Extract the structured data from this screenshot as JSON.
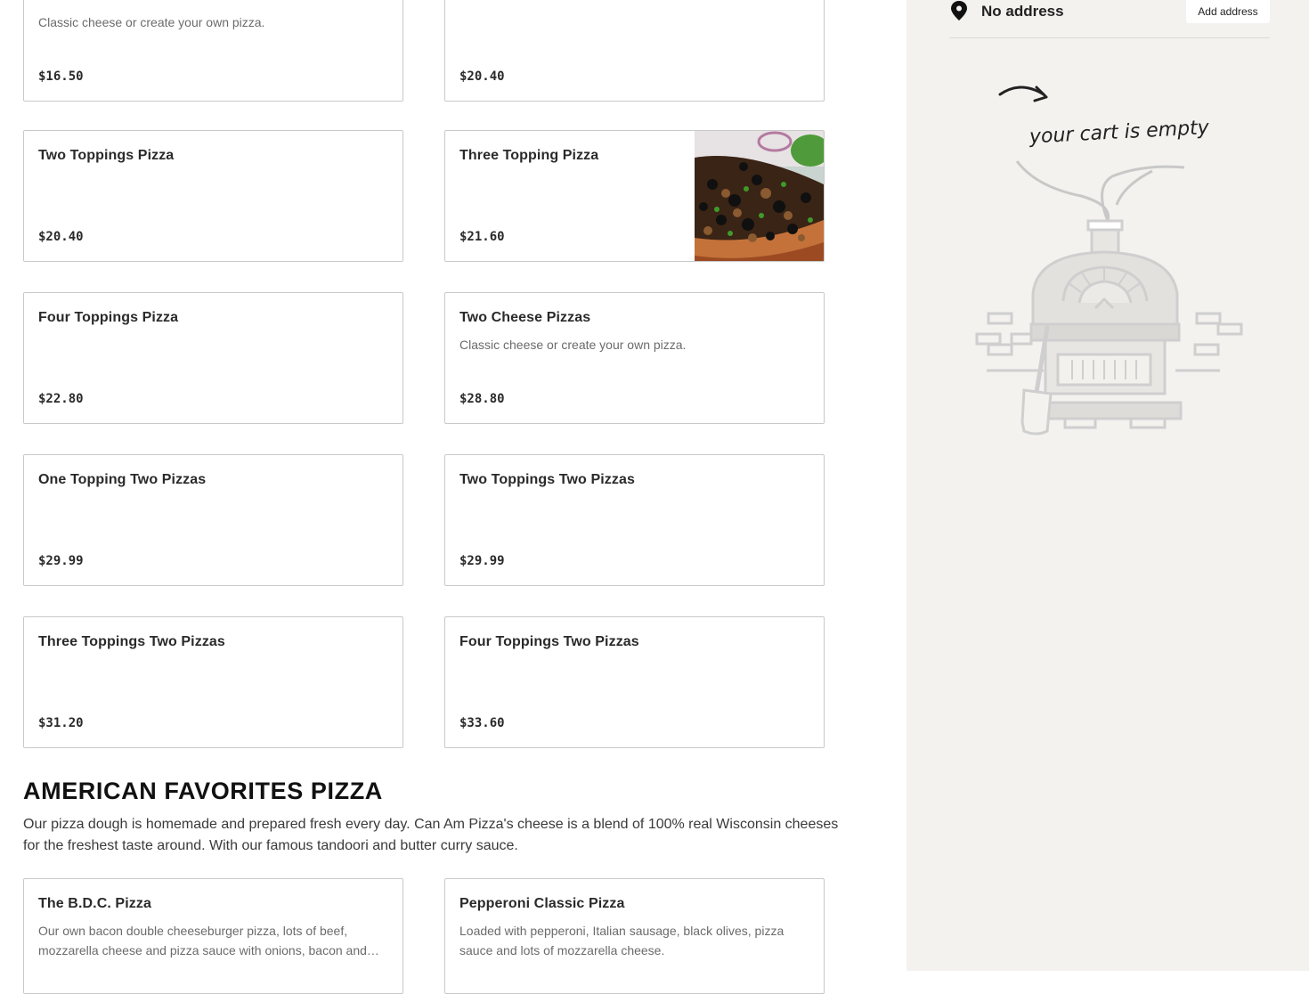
{
  "menu_items": [
    {
      "name": "",
      "description": "Classic cheese or create your own pizza.",
      "price": "$16.50"
    },
    {
      "name": "",
      "description": "",
      "price": "$20.40"
    },
    {
      "name": "Two Toppings Pizza",
      "description": "",
      "price": "$20.40"
    },
    {
      "name": "Three Topping Pizza",
      "description": "",
      "price": "$21.60",
      "image": "pizza-photo"
    },
    {
      "name": "Four Toppings Pizza",
      "description": "",
      "price": "$22.80"
    },
    {
      "name": "Two Cheese Pizzas",
      "description": "Classic cheese or create your own pizza.",
      "price": "$28.80"
    },
    {
      "name": "One Topping Two Pizzas",
      "description": "",
      "price": "$29.99"
    },
    {
      "name": "Two Toppings Two Pizzas",
      "description": "",
      "price": "$29.99"
    },
    {
      "name": "Three Toppings Two Pizzas",
      "description": "",
      "price": "$31.20"
    },
    {
      "name": "Four Toppings Two Pizzas",
      "description": "",
      "price": "$33.60"
    }
  ],
  "section": {
    "title": "AMERICAN FAVORITES PIZZA",
    "description": "Our pizza dough is homemade and prepared fresh every day. Can Am Pizza's cheese is a blend of 100% real Wisconsin cheeses for the freshest taste around. With our famous tandoori and butter curry sauce."
  },
  "section_items": [
    {
      "name": "The B.D.C. Pizza",
      "description": "Our own bacon double cheeseburger pizza, lots of beef, mozzarella cheese and pizza sauce with onions, bacon and…"
    },
    {
      "name": "Pepperoni Classic Pizza",
      "description": "Loaded with pepperoni, Italian sausage, black olives, pizza sauce and lots of mozzarella cheese."
    }
  ],
  "sidebar": {
    "address_icon": "map-pin-icon",
    "address_text": "No address",
    "add_address_label": "Add address",
    "cart_empty_text": "your cart is empty",
    "cart_illustration": "pizza-oven-illustration"
  },
  "colors": {
    "sidebar_bg": "#f3f2ef",
    "card_border": "#c9c9c9",
    "muted_text": "#6b6b6b"
  }
}
